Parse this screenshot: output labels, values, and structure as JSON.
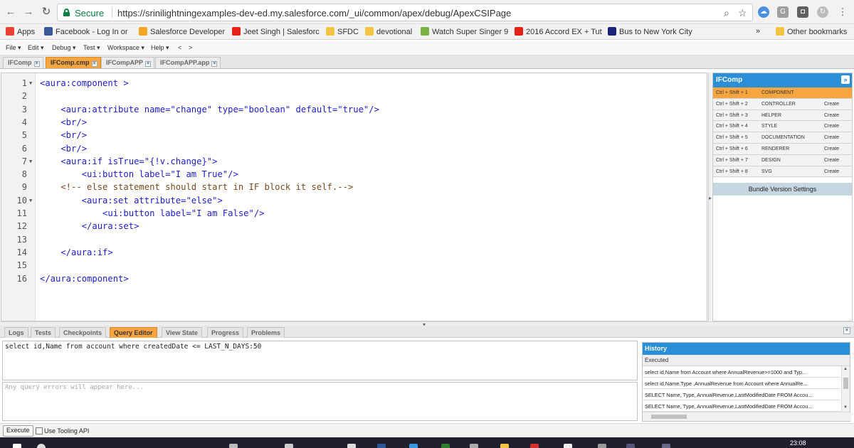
{
  "browser": {
    "secure_label": "Secure",
    "url": "https://srinilightningexamples-dev-ed.my.salesforce.com/_ui/common/apex/debug/ApexCSIPage",
    "bookmarks": [
      {
        "label": "Apps",
        "color": "#e94235"
      },
      {
        "label": "Facebook - Log In or",
        "color": "#3b5998"
      },
      {
        "label": "Salesforce Developer",
        "color": "#f5a623"
      },
      {
        "label": "Jeet Singh | Salesforc",
        "color": "#e62117"
      },
      {
        "label": "SFDC",
        "color": "#f4c542"
      },
      {
        "label": "devotional",
        "color": "#f4c542"
      },
      {
        "label": "Watch Super Singer 9",
        "color": "#7bb342"
      },
      {
        "label": "2016 Accord EX + Tut",
        "color": "#e62117"
      },
      {
        "label": "Bus to New York City",
        "color": "#1a237e"
      }
    ],
    "more": "»",
    "other_bookmarks": "Other bookmarks"
  },
  "menu": {
    "items": [
      "File ▾",
      "Edit ▾",
      "Debug ▾",
      "Test ▾",
      "Workspace ▾",
      "Help ▾",
      "<",
      ">"
    ]
  },
  "file_tabs": [
    {
      "label": "IFComp",
      "active": false
    },
    {
      "label": "IFComp.cmp",
      "active": true
    },
    {
      "label": "IFCompAPP",
      "active": false
    },
    {
      "label": "IFCompAPP.app",
      "active": false
    }
  ],
  "editor": {
    "line_numbers": [
      "1",
      "2",
      "3",
      "4",
      "5",
      "6",
      "7",
      "8",
      "9",
      "10",
      "11",
      "12",
      "13",
      "14",
      "15",
      "16"
    ],
    "lines": [
      "<aura:component >",
      "",
      "    <aura:attribute name=\"change\" type=\"boolean\" default=\"true\"/>",
      "    <br/>",
      "    <br/>",
      "    <br/>",
      "    <aura:if isTrue=\"{!v.change}\">",
      "        <ui:button label=\"I am True\"/>",
      "    <!-- else statement should start in IF block it self.-->",
      "        <aura:set attribute=\"else\">",
      "            <ui:button label=\"I am False\"/>",
      "        </aura:set>",
      "",
      "    </aura:if>",
      "",
      "</aura:component>"
    ]
  },
  "bundle": {
    "title": "IFComp",
    "collapse_glyph": "»",
    "rows": [
      {
        "shortcut": "Ctrl + Shift + 1",
        "name": "COMPONENT",
        "action": "",
        "selected": true
      },
      {
        "shortcut": "Ctrl + Shift + 2",
        "name": "CONTROLLER",
        "action": "Create",
        "selected": false
      },
      {
        "shortcut": "Ctrl + Shift + 3",
        "name": "HELPER",
        "action": "Create",
        "selected": false
      },
      {
        "shortcut": "Ctrl + Shift + 4",
        "name": "STYLE",
        "action": "Create",
        "selected": false
      },
      {
        "shortcut": "Ctrl + Shift + 5",
        "name": "DOCUMENTATION",
        "action": "Create",
        "selected": false
      },
      {
        "shortcut": "Ctrl + Shift + 6",
        "name": "RENDERER",
        "action": "Create",
        "selected": false
      },
      {
        "shortcut": "Ctrl + Shift + 7",
        "name": "DESIGN",
        "action": "Create",
        "selected": false
      },
      {
        "shortcut": "Ctrl + Shift + 8",
        "name": "SVG",
        "action": "Create",
        "selected": false
      }
    ],
    "version_settings": "Bundle Version Settings"
  },
  "bottom_tabs": [
    {
      "label": "Logs",
      "active": false
    },
    {
      "label": "Tests",
      "active": false
    },
    {
      "label": "Checkpoints",
      "active": false
    },
    {
      "label": "Query Editor",
      "active": true
    },
    {
      "label": "View State",
      "active": false
    },
    {
      "label": "Progress",
      "active": false
    },
    {
      "label": "Problems",
      "active": false
    }
  ],
  "query": {
    "text": "select id,Name from account where createdDate <= LAST_N_DAYS:50",
    "errors_placeholder": "Any query errors will appear here..."
  },
  "history": {
    "title": "History",
    "column": "Executed",
    "rows": [
      "select id,Name from Account where AnnualRevenue>=1000 and Typ...",
      "select id,Name,Type ,AnnualRevenue from Account where AnnualRe...",
      "SELECT Name, Type, AnnualRevenue,LastModifiedDate FROM Accou...",
      "SELECT Name, Type, AnnualRevenue,LastModifiedDate FROM Accou..."
    ]
  },
  "footer": {
    "execute_label": "Execute",
    "tooling_label": "Use Tooling API"
  },
  "taskbar": {
    "clock": "23:08"
  },
  "colors": {
    "accent_orange": "#f6a541",
    "panel_blue": "#2a8fd6",
    "secure_green": "#0b8043"
  }
}
